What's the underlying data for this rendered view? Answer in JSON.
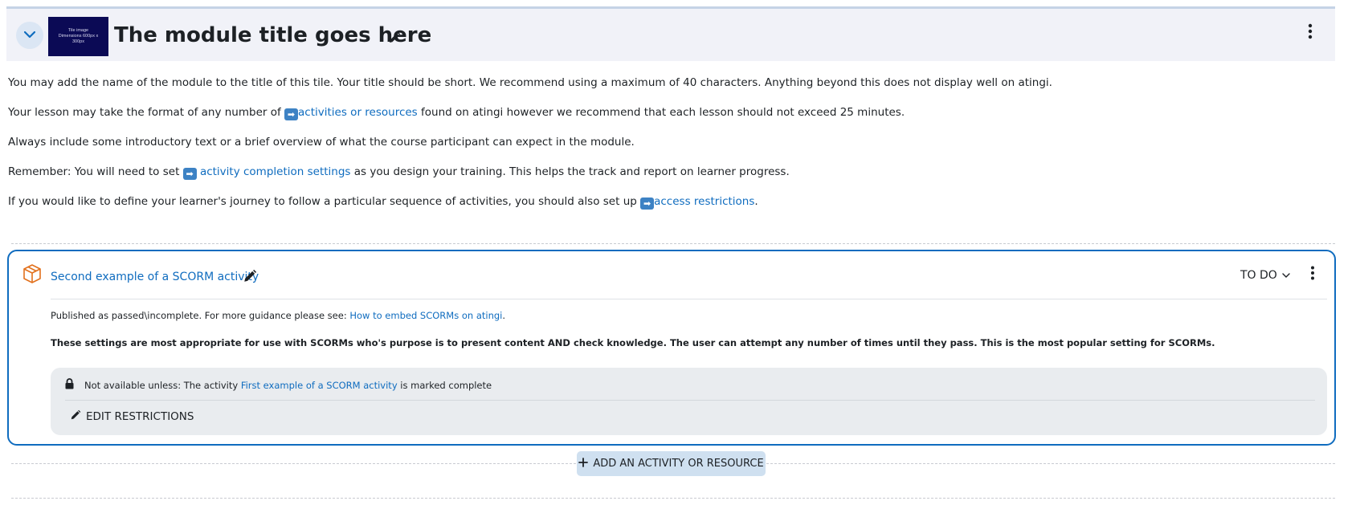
{
  "module": {
    "title": "The module title goes here",
    "thumbnail_text": "Tile image Dimensions 600px x 300px"
  },
  "intro": {
    "p1": "You may add the name of the module to the title of this tile.  Your title should be short. We recommend using a maximum of 40 characters. Anything beyond this does not display well on atingi.",
    "p2_before": "Your lesson may take the format of any number of ",
    "p2_link": "activities or resources",
    "p2_after": " found on atingi however we recommend that each lesson should not exceed 25 minutes.",
    "p3": "Always include some introductory text or a brief overview of what the course participant can expect in the module.",
    "p4_before": "Remember: You will need to set ",
    "p4_link": " activity completion settings",
    "p4_after": " as you design your training. This helps the track and report on learner progress.",
    "p5_before": "If you would like to define your learner's journey to follow a particular sequence of activities, you should also set up ",
    "p5_link": "access restrictions",
    "p5_after": ".",
    "arrow_glyph": "➡"
  },
  "activity": {
    "name": "Second example of a SCORM activity",
    "completion_status": "TO DO",
    "desc1_before": "Published as passed\\incomplete. For more guidance please see: ",
    "desc1_link": "How to embed SCORMs on atingi",
    "desc1_after": ".",
    "desc2": "These settings are most appropriate for use with SCORMs who's purpose is to present content AND check knowledge. The user can attempt any number of times until they pass. This is the most popular setting for SCORMs.",
    "restriction": {
      "before": "Not available unless: The activity ",
      "link": "First example of a SCORM activity",
      "after": " is marked complete",
      "edit_label": "EDIT RESTRICTIONS"
    }
  },
  "add_activity_label": "ADD AN ACTIVITY OR RESOURCE",
  "colors": {
    "accent": "#0f6cbf",
    "header_bg": "#f1f2f8",
    "restriction_bg": "#e9ecef",
    "add_button_bg": "#cfe0f0",
    "scorm_icon": "#e2711d"
  }
}
